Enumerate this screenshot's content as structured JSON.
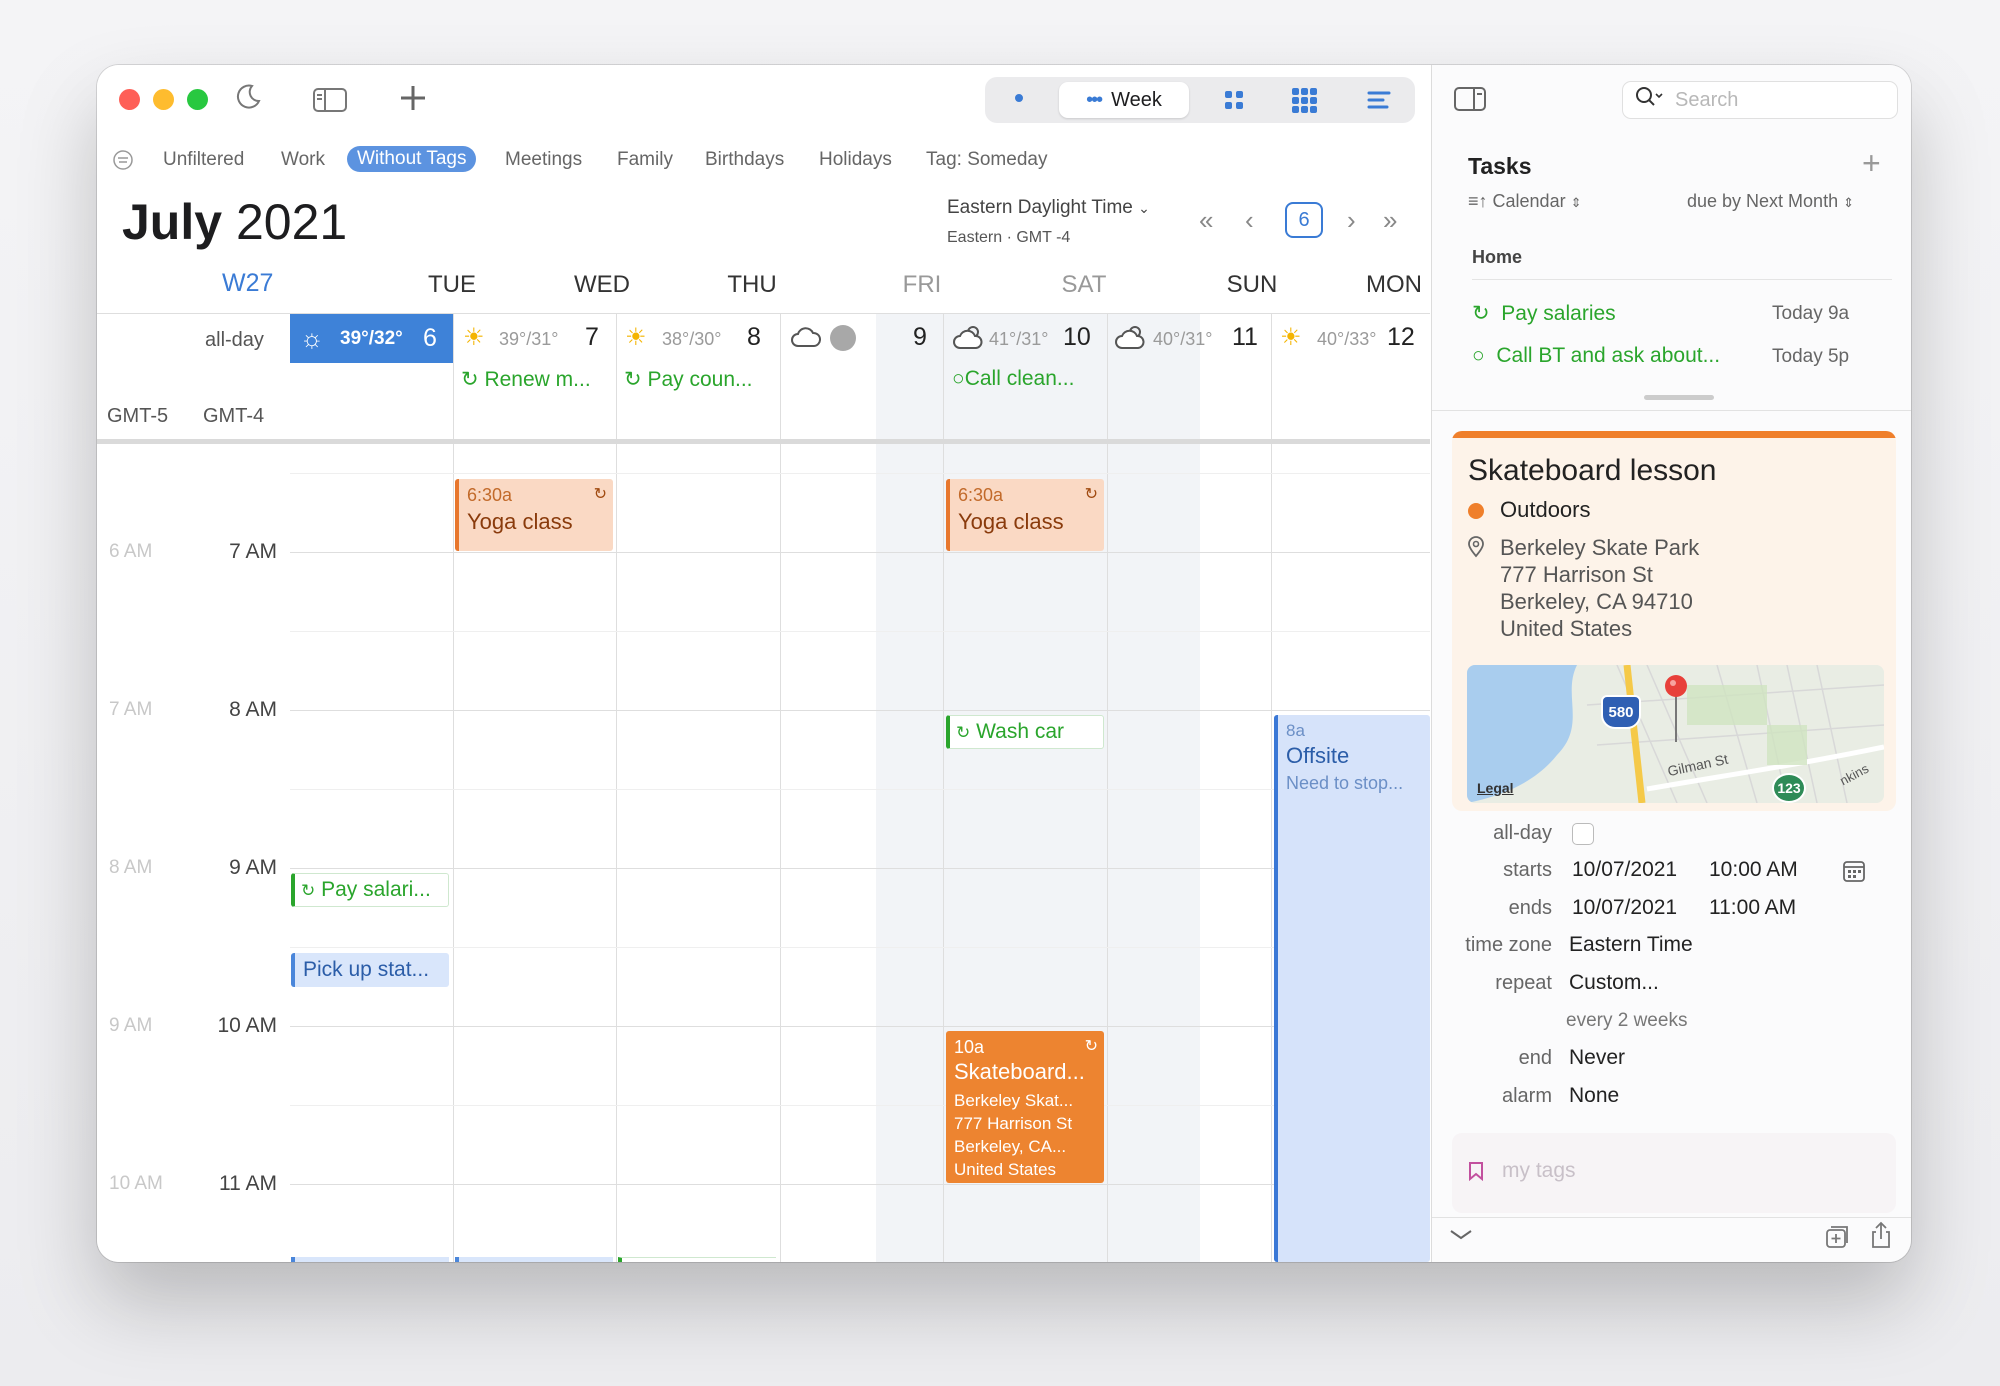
{
  "toolbar": {
    "view_label": "Week",
    "icons": [
      "moon-icon",
      "sidebar-icon",
      "plus-icon",
      "day-view-icon",
      "month-view-icon",
      "year-view-icon",
      "list-view-icon"
    ]
  },
  "filters": [
    "Unfiltered",
    "Work",
    "Without Tags",
    "Meetings",
    "Family",
    "Birthdays",
    "Holidays",
    "Tag: Someday"
  ],
  "active_filter": "Without Tags",
  "header": {
    "month": "July",
    "year": "2021",
    "timezone": "Eastern Daylight Time",
    "timezone_sub": "Eastern · GMT -4",
    "today_button": "6",
    "week": "W27"
  },
  "days": [
    {
      "name": "TUE",
      "num": "6",
      "temp": "39°/32°",
      "weather": "sun"
    },
    {
      "name": "WED",
      "num": "7",
      "temp": "39°/31°",
      "weather": "sun"
    },
    {
      "name": "THU",
      "num": "8",
      "temp": "38°/30°",
      "weather": "sun"
    },
    {
      "name": "FRI",
      "num": "9",
      "temp": "",
      "weather": "cloud"
    },
    {
      "name": "SAT",
      "num": "10",
      "temp": "41°/31°",
      "weather": "cloud-sun"
    },
    {
      "name": "SUN",
      "num": "11",
      "temp": "40°/31°",
      "weather": "cloud-sun"
    },
    {
      "name": "MON",
      "num": "12",
      "temp": "40°/33°",
      "weather": "sun"
    }
  ],
  "allday": {
    "label": "all-day",
    "tz1": "GMT-5",
    "tz2": "GMT-4",
    "tasks": {
      "wed": "Renew m...",
      "thu": "Pay coun...",
      "sat": "Call clean..."
    }
  },
  "hours": {
    "primary": [
      "7 AM",
      "8 AM",
      "9 AM",
      "10 AM",
      "11 AM"
    ],
    "secondary": [
      "6 AM",
      "7 AM",
      "8 AM",
      "9 AM",
      "10 AM"
    ]
  },
  "events": {
    "yoga_wed": {
      "time": "6:30a",
      "title": "Yoga class"
    },
    "yoga_sat": {
      "time": "6:30a",
      "title": "Yoga class"
    },
    "wash_car": "Wash car",
    "pay_salari": "Pay salari...",
    "pick_up": "Pick up stat...",
    "offsite": {
      "time": "8a",
      "title": "Offsite",
      "note": "Need to stop..."
    },
    "skate": {
      "time": "10a",
      "title": "Skateboard...",
      "l1": "Berkeley Skat...",
      "l2": "777 Harrison St",
      "l3": "Berkeley, CA...",
      "l4": "United States"
    }
  },
  "panel": {
    "search_placeholder": "Search",
    "tasks_title": "Tasks",
    "calendar_selector": "Calendar",
    "due_selector": "due by Next Month",
    "group": "Home",
    "tasks": [
      {
        "title": "Pay salaries",
        "time": "Today 9a"
      },
      {
        "title": "Call BT and ask about...",
        "time": "Today 5p"
      }
    ]
  },
  "detail": {
    "title": "Skateboard lesson",
    "calendar": "Outdoors",
    "calendar_color": "#ef7f2b",
    "location": [
      "Berkeley Skate Park",
      "777 Harrison St",
      "Berkeley, CA  94710",
      "United States"
    ],
    "map": {
      "legal": "Legal",
      "street": "Gilman St",
      "hwy1": "580",
      "hwy2": "123",
      "street2": "nkins"
    },
    "fields": {
      "allday_label": "all-day",
      "starts_label": "starts",
      "starts_date": "10/07/2021",
      "starts_time": "10:00 AM",
      "ends_label": "ends",
      "ends_date": "10/07/2021",
      "ends_time": "11:00 AM",
      "tz_label": "time zone",
      "tz_value": "Eastern Time",
      "repeat_label": "repeat",
      "repeat_value": "Custom...",
      "repeat_detail": "every 2 weeks",
      "end_label": "end",
      "end_value": "Never",
      "alarm_label": "alarm",
      "alarm_value": "None"
    },
    "tags_placeholder": "my tags"
  },
  "colors": {
    "accent": "#3a7bd5",
    "task_green": "#2aa52c",
    "orange": "#ef7f2b"
  }
}
